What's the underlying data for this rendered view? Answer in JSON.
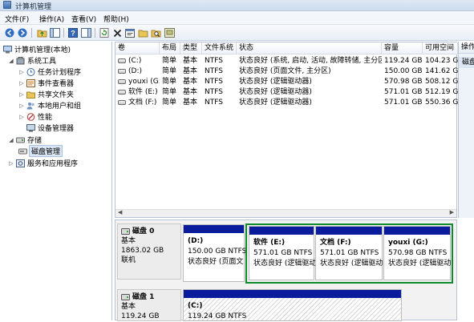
{
  "window": {
    "title": "计算机管理"
  },
  "menu": [
    "文件(F)",
    "操作(A)",
    "查看(V)",
    "帮助(H)"
  ],
  "toolbar": {
    "buttons": [
      "back-icon",
      "forward-icon",
      "up-folder-icon",
      "show-hide-tree-icon",
      "help-icon",
      "show-hide-action-icon",
      "refresh-icon",
      "delete-icon",
      "properties-icon",
      "open-folder-icon",
      "search-icon",
      "disk-icon"
    ]
  },
  "tree": {
    "root": "计算机管理(本地)",
    "system_tools": "系统工具",
    "task_scheduler": "任务计划程序",
    "event_viewer": "事件查看器",
    "shared_folders": "共享文件夹",
    "local_users": "本地用户和组",
    "performance": "性能",
    "device_manager": "设备管理器",
    "storage": "存储",
    "disk_management": "磁盘管理",
    "services_apps": "服务和应用程序"
  },
  "volumes": {
    "headers": [
      "卷",
      "布局",
      "类型",
      "文件系统",
      "状态",
      "容量",
      "可用空间"
    ],
    "rows": [
      {
        "vol": "(C:)",
        "layout": "简单",
        "type": "基本",
        "fs": "NTFS",
        "status": "状态良好 (系统, 启动, 活动, 故障转储, 主分区)",
        "capacity": "119.24 GB",
        "free": "104.23 G"
      },
      {
        "vol": "(D:)",
        "layout": "简单",
        "type": "基本",
        "fs": "NTFS",
        "status": "状态良好 (页面文件, 主分区)",
        "capacity": "150.00 GB",
        "free": "141.62 G"
      },
      {
        "vol": "youxi (G:)",
        "layout": "简单",
        "type": "基本",
        "fs": "NTFS",
        "status": "状态良好 (逻辑驱动器)",
        "capacity": "570.98 GB",
        "free": "508.12 G"
      },
      {
        "vol": "软件 (E:)",
        "layout": "简单",
        "type": "基本",
        "fs": "NTFS",
        "status": "状态良好 (逻辑驱动器)",
        "capacity": "571.01 GB",
        "free": "512.19 G"
      },
      {
        "vol": "文档 (F:)",
        "layout": "简单",
        "type": "基本",
        "fs": "NTFS",
        "status": "状态良好 (逻辑驱动器)",
        "capacity": "571.01 GB",
        "free": "550.36 G"
      }
    ]
  },
  "actions": {
    "header": "操作",
    "item": "磁盘"
  },
  "disks": [
    {
      "name": "磁盘 0",
      "type": "基本",
      "size": "1863.02 GB",
      "state": "联机",
      "partitions": [
        {
          "label": "(D:)",
          "size": "150.00 GB NTFS",
          "status": "状态良好 (页面文"
        },
        {
          "label": "软件 (E:)",
          "size": "571.01 GB NTFS",
          "status": "状态良好 (逻辑驱动"
        },
        {
          "label": "文档 (F:)",
          "size": "571.01 GB NTFS",
          "status": "状态良好 (逻辑驱动"
        },
        {
          "label": "youxi (G:)",
          "size": "570.98 GB NTFS",
          "status": "状态良好 (逻辑驱动"
        }
      ]
    },
    {
      "name": "磁盘 1",
      "type": "基本",
      "size": "119.24 GB",
      "partitions": [
        {
          "label": "(C:)",
          "size": "119.24 GB NTFS"
        }
      ]
    }
  ],
  "colors": {
    "partition_bar": "#0a1c9c",
    "extended_border": "#0f8a2c"
  }
}
